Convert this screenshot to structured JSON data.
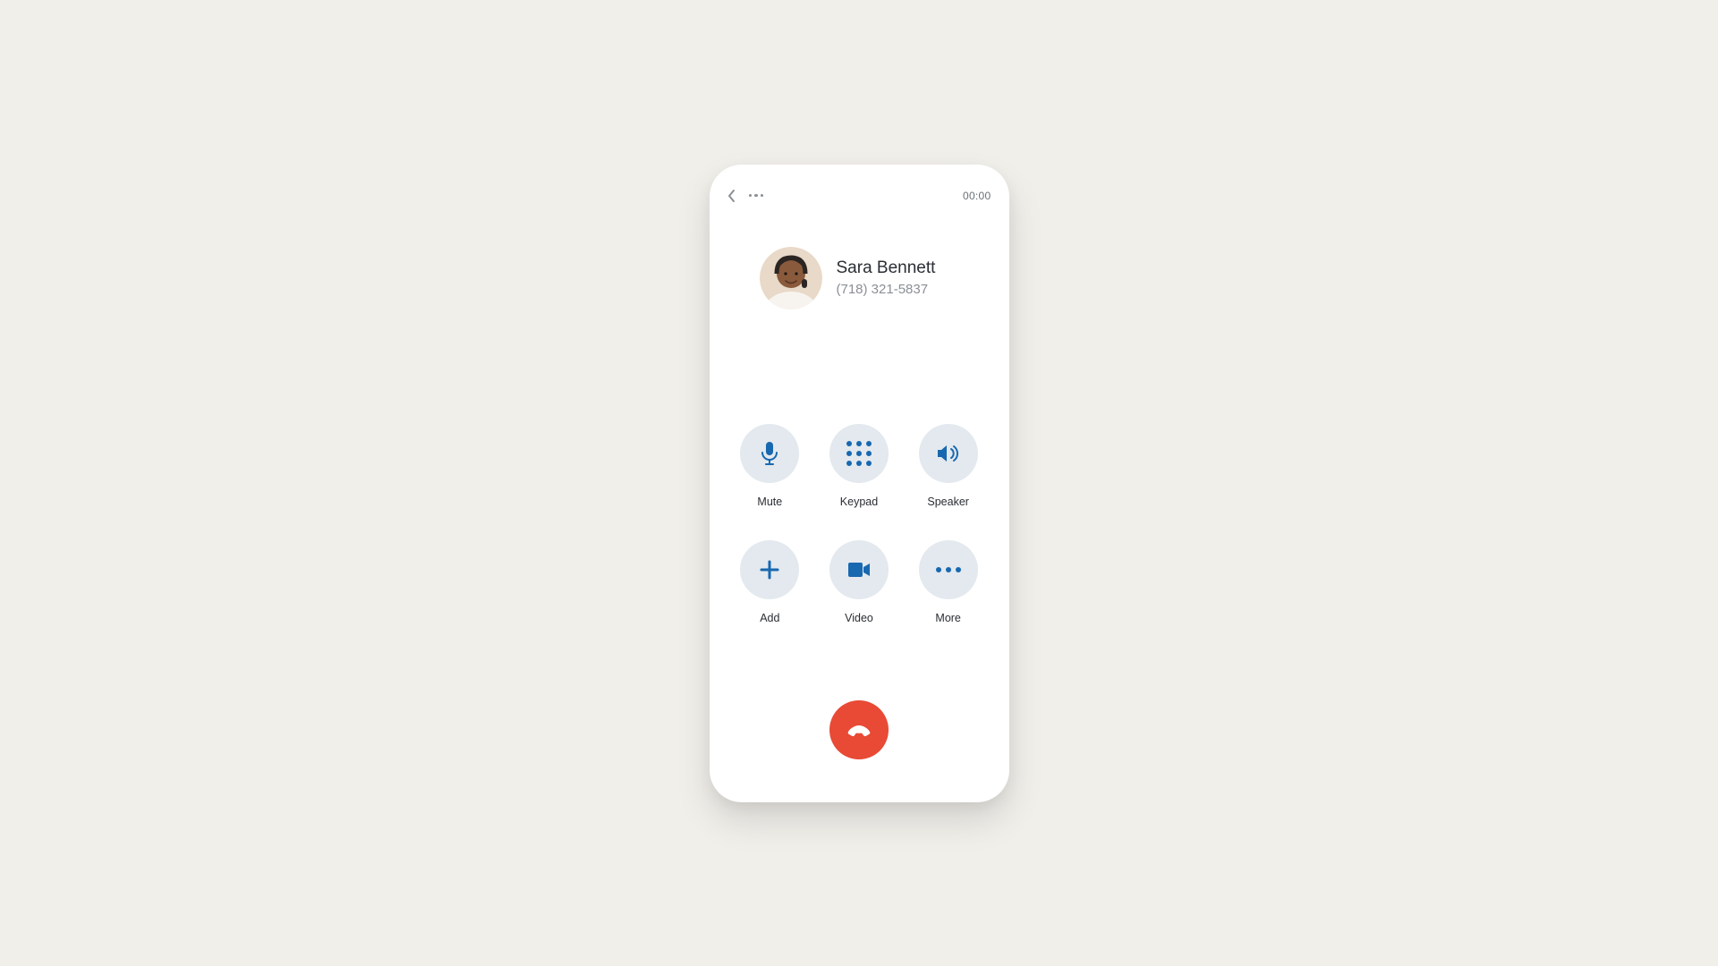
{
  "call": {
    "timer": "00:00",
    "caller_name": "Sara Bennett",
    "caller_phone": "(718) 321-5837"
  },
  "controls": {
    "mute": "Mute",
    "keypad": "Keypad",
    "speaker": "Speaker",
    "add": "Add",
    "video": "Video",
    "more": "More"
  },
  "colors": {
    "icon_blue": "#1868b0",
    "hangup_red": "#e84a35",
    "button_bg": "#e3e9ee"
  }
}
